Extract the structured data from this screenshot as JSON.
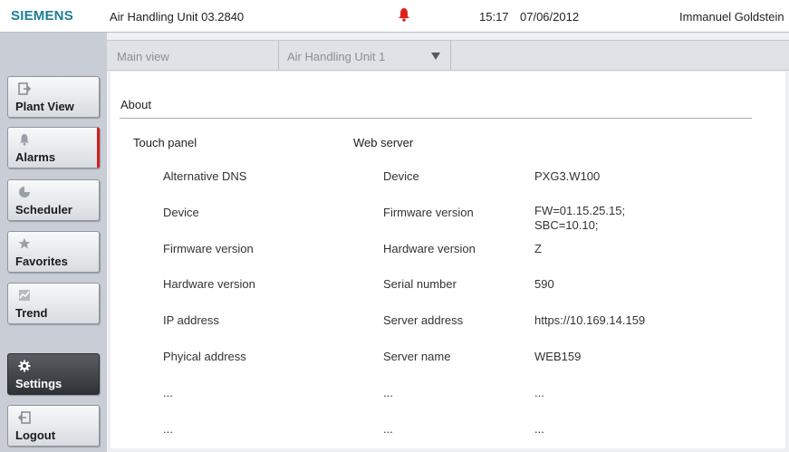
{
  "topbar": {
    "brand": "SIEMENS",
    "unit_title": "Air Handling Unit 03.2840",
    "time": "15:17",
    "date": "07/06/2012",
    "user": "Immanuel Goldstein",
    "alarm_icon": "bell-icon",
    "alarm_color": "#e0201c"
  },
  "sidebar": {
    "items": [
      {
        "label": "Plant View",
        "icon": "plant-view-icon"
      },
      {
        "label": "Alarms",
        "icon": "bell-icon"
      },
      {
        "label": "Scheduler",
        "icon": "clock-icon"
      },
      {
        "label": "Favorites",
        "icon": "star-icon"
      },
      {
        "label": "Trend",
        "icon": "trend-icon"
      },
      {
        "label": "Settings",
        "icon": "gear-icon"
      },
      {
        "label": "Logout",
        "icon": "logout-icon"
      }
    ],
    "active": "Settings"
  },
  "tabs": {
    "main": "Main view",
    "selector": "Air Handling Unit 1"
  },
  "about": {
    "title": "About",
    "touch_panel": {
      "heading": "Touch panel",
      "rows": [
        "Alternative DNS",
        "Device",
        "Firmware version",
        "Hardware version",
        "IP address",
        "Phyical address",
        "...",
        "..."
      ]
    },
    "web_server": {
      "heading": "Web server",
      "labels": [
        "Device",
        "Firmware version",
        "Hardware version",
        "Serial number",
        "Server address",
        "Server name",
        "...",
        "..."
      ],
      "values": [
        "PXG3.W100",
        "FW=01.15.25.15;\nSBC=10.10;",
        "Z",
        "590",
        "https://10.169.14.159",
        "WEB159",
        "...",
        "..."
      ]
    }
  },
  "colors": {
    "brand": "#1b7f94",
    "alarm_accent": "#d02020",
    "active_button": "#3a3d42"
  }
}
